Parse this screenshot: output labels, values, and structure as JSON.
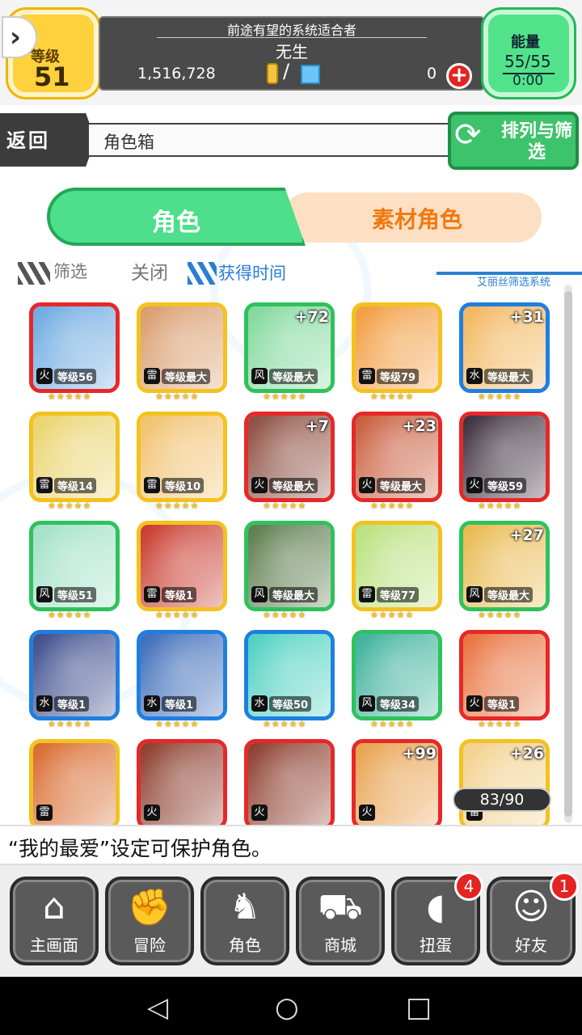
{
  "header": {
    "level_label": "等级",
    "level_value": "51",
    "subtitle": "前途有望的系统适合者",
    "player_name": "无生",
    "gold": "1,516,728",
    "slash": "/",
    "gems": "0",
    "energy_label": "能量",
    "energy_value": "55/55",
    "energy_timer": "0:00"
  },
  "nav": {
    "back_label": "返回",
    "breadcrumb": "角色箱",
    "sort_filter_label": "排列与筛选"
  },
  "tabs": {
    "characters": "角色",
    "material": "素材角色"
  },
  "filter": {
    "filter_label": "筛选",
    "filter_state": "关闭",
    "sort_label": "获得时间",
    "system_label": "艾丽丝筛选系统"
  },
  "cards": [
    {
      "frame": "#e62828",
      "elem": "火",
      "level": "等级56",
      "plus": "",
      "art": "#6aa8e0"
    },
    {
      "frame": "#f3c21f",
      "elem": "雷",
      "level": "等级最大",
      "plus": "",
      "art": "#d99a6a"
    },
    {
      "frame": "#2fc25c",
      "elem": "风",
      "level": "等级最大",
      "plus": "+72",
      "art": "#7fd89a"
    },
    {
      "frame": "#f3c21f",
      "elem": "雷",
      "level": "等级79",
      "plus": "",
      "art": "#f29b3c"
    },
    {
      "frame": "#1f7fe0",
      "elem": "水",
      "level": "等级最大",
      "plus": "+31",
      "art": "#f2b55a"
    },
    {
      "frame": "#f3c21f",
      "elem": "雷",
      "level": "等级14",
      "plus": "",
      "art": "#e9d36a"
    },
    {
      "frame": "#f3c21f",
      "elem": "雷",
      "level": "等级10",
      "plus": "",
      "art": "#f1c06b"
    },
    {
      "frame": "#e62828",
      "elem": "火",
      "level": "等级最大",
      "plus": "+7",
      "art": "#8a4a3c"
    },
    {
      "frame": "#e62828",
      "elem": "火",
      "level": "等级最大",
      "plus": "+23",
      "art": "#c85a3a"
    },
    {
      "frame": "#e62828",
      "elem": "火",
      "level": "等级59",
      "plus": "",
      "art": "#3a2b3a"
    },
    {
      "frame": "#2fc25c",
      "elem": "风",
      "level": "等级51",
      "plus": "",
      "art": "#9fe0c8"
    },
    {
      "frame": "#f3c21f",
      "elem": "雷",
      "level": "等级1",
      "plus": "",
      "art": "#c8372a"
    },
    {
      "frame": "#2fc25c",
      "elem": "风",
      "level": "等级最大",
      "plus": "",
      "art": "#5a7a4a"
    },
    {
      "frame": "#f3c21f",
      "elem": "雷",
      "level": "等级77",
      "plus": "",
      "art": "#b8e07a"
    },
    {
      "frame": "#2fc25c",
      "elem": "风",
      "level": "等级最大",
      "plus": "+27",
      "art": "#e8b84a"
    },
    {
      "frame": "#1f7fe0",
      "elem": "水",
      "level": "等级1",
      "plus": "",
      "art": "#3a4a8a"
    },
    {
      "frame": "#1f7fe0",
      "elem": "水",
      "level": "等级1",
      "plus": "",
      "art": "#3a6ab8"
    },
    {
      "frame": "#1f7fe0",
      "elem": "水",
      "level": "等级50",
      "plus": "",
      "art": "#4ad0c0"
    },
    {
      "frame": "#2fc25c",
      "elem": "风",
      "level": "等级34",
      "plus": "",
      "art": "#3ab09a"
    },
    {
      "frame": "#e62828",
      "elem": "火",
      "level": "等级1",
      "plus": "",
      "art": "#e8703a"
    },
    {
      "frame": "#f3c21f",
      "elem": "雷",
      "level": "",
      "plus": "",
      "art": "#d8682a"
    },
    {
      "frame": "#e62828",
      "elem": "火",
      "level": "",
      "plus": "",
      "art": "#8a3a2a"
    },
    {
      "frame": "#e62828",
      "elem": "火",
      "level": "",
      "plus": "",
      "art": "#8a3a2a"
    },
    {
      "frame": "#e62828",
      "elem": "火",
      "level": "",
      "plus": "+99",
      "art": "#e8a04a"
    },
    {
      "frame": "#f3c21f",
      "elem": "雷",
      "level": "",
      "plus": "+26",
      "art": "#f2d08a"
    }
  ],
  "stars": "★★★★★",
  "box_count": "83/90",
  "tip": "“我的最爱”设定可保护角色。",
  "bottom_nav": [
    {
      "label": "主画面",
      "icon": "home-icon",
      "glyph": "⌂",
      "badge": ""
    },
    {
      "label": "冒险",
      "icon": "handshake-icon",
      "glyph": "✊",
      "badge": ""
    },
    {
      "label": "角色",
      "icon": "rabbit-icon",
      "glyph": "♞",
      "badge": ""
    },
    {
      "label": "商城",
      "icon": "cart-icon",
      "glyph": "⛟",
      "badge": ""
    },
    {
      "label": "扭蛋",
      "icon": "egg-icon",
      "glyph": "◖",
      "badge": "4"
    },
    {
      "label": "好友",
      "icon": "friends-icon",
      "glyph": "☺",
      "badge": "1"
    }
  ],
  "android": {
    "back": "◁",
    "home": "○",
    "recent": "□"
  }
}
